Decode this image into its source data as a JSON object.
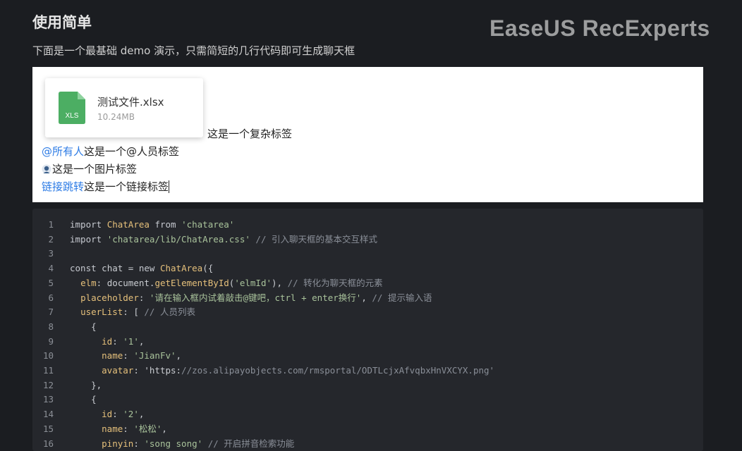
{
  "section": {
    "title": "使用简单",
    "subtitle": "下面是一个最基础 demo 演示，只需简短的几行代码即可生成聊天框"
  },
  "watermark": "EaseUS RecExperts",
  "demo": {
    "file": {
      "icon_label": "XLS",
      "name": "测试文件.xlsx",
      "size": "10.24MB",
      "icon_color": "#4cae63"
    },
    "complex_label": "这是一个复杂标签",
    "mention": "@所有人",
    "mention_label": "这是一个@人员标签",
    "image_label": "这是一个图片标签",
    "link": "链接跳转",
    "link_label": "这是一个链接标签"
  },
  "code": {
    "lines": [
      {
        "n": "1",
        "text": "import ChatArea from 'chatarea'"
      },
      {
        "n": "2",
        "text": "import 'chatarea/lib/ChatArea.css' // 引入聊天框的基本交互样式"
      },
      {
        "n": "3",
        "text": ""
      },
      {
        "n": "4",
        "text": "const chat = new ChatArea({"
      },
      {
        "n": "5",
        "text": "  elm: document.getElementById('elmId'), // 转化为聊天框的元素"
      },
      {
        "n": "6",
        "text": "  placeholder: '请在输入框内试着敲击@键吧，ctrl + enter换行', // 提示输入语"
      },
      {
        "n": "7",
        "text": "  userList: [ // 人员列表"
      },
      {
        "n": "8",
        "text": "    {"
      },
      {
        "n": "9",
        "text": "      id: '1',"
      },
      {
        "n": "10",
        "text": "      name: 'JianFv',"
      },
      {
        "n": "11",
        "text": "      avatar: 'https://zos.alipayobjects.com/rmsportal/ODTLcjxAfvqbxHnVXCYX.png'"
      },
      {
        "n": "12",
        "text": "    },"
      },
      {
        "n": "13",
        "text": "    {"
      },
      {
        "n": "14",
        "text": "      id: '2',"
      },
      {
        "n": "15",
        "text": "      name: '松松',"
      },
      {
        "n": "16",
        "text": "      pinyin: 'song song' // 开启拼音检索功能"
      }
    ]
  }
}
